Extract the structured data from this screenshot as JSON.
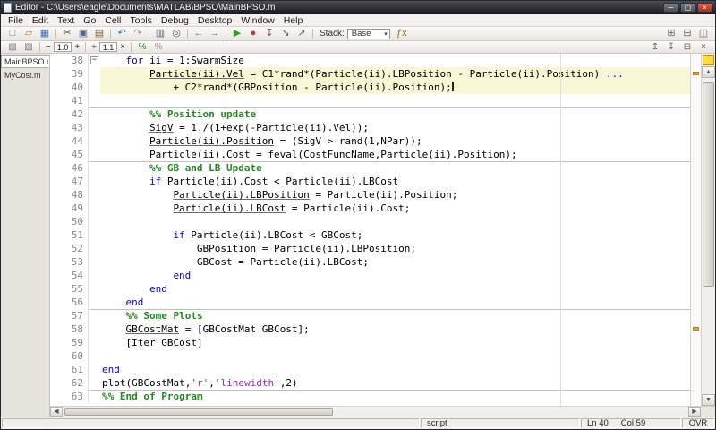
{
  "window": {
    "title": "Editor - C:\\Users\\eagle\\Documents\\MATLAB\\BPSO\\MainBPSO.m",
    "controls": {
      "minimize": "─",
      "maximize": "▢",
      "close": "×"
    }
  },
  "icons": {
    "up": "▲",
    "down": "▼",
    "left": "◀",
    "right": "▶"
  },
  "menu": {
    "items": [
      "File",
      "Edit",
      "Text",
      "Go",
      "Cell",
      "Tools",
      "Debug",
      "Desktop",
      "Window",
      "Help"
    ]
  },
  "toolbar1": {
    "stack_label": "Stack:",
    "stack_value": "Base",
    "items": [
      {
        "n": "new-script-icon",
        "g": "□",
        "c": "#6f6f6f"
      },
      {
        "n": "open-file-icon",
        "g": "▱",
        "c": "#b8860b"
      },
      {
        "n": "save-icon",
        "g": "▦",
        "c": "#3b66b0"
      },
      {
        "sep": true
      },
      {
        "n": "cut-icon",
        "g": "✂",
        "c": "#555555"
      },
      {
        "n": "copy-icon",
        "g": "▣",
        "c": "#556688"
      },
      {
        "n": "paste-icon",
        "g": "▤",
        "c": "#8a5a2a"
      },
      {
        "sep": true
      },
      {
        "n": "undo-icon",
        "g": "↶",
        "c": "#2d7dc1"
      },
      {
        "n": "redo-icon",
        "g": "↷",
        "c": "#9a9a9a"
      },
      {
        "sep": true
      },
      {
        "n": "print-icon",
        "g": "▥",
        "c": "#5a5a66"
      },
      {
        "n": "find-files-icon",
        "g": "◎",
        "c": "#5a5a66"
      },
      {
        "sep": true
      },
      {
        "n": "back-icon",
        "g": "←",
        "c": "#2d7dc1"
      },
      {
        "n": "forward-icon",
        "g": "→",
        "c": "#2d7dc1"
      },
      {
        "sep": true
      },
      {
        "n": "run-icon",
        "g": "▶",
        "c": "#2f9e2f"
      },
      {
        "n": "breakpoint-icon",
        "g": "●",
        "c": "#c23b2e"
      },
      {
        "n": "step-icon",
        "g": "↧",
        "c": "#55606e"
      },
      {
        "n": "step-in-icon",
        "g": "↘",
        "c": "#55606e"
      },
      {
        "n": "step-out-icon",
        "g": "↗",
        "c": "#55606e"
      },
      {
        "sep": true
      },
      {
        "stack": true
      },
      {
        "n": "function-browser-icon",
        "g": "ƒx",
        "c": "#8a6d1f"
      }
    ],
    "right_icons": [
      {
        "n": "tile-windows-icon",
        "g": "⊞",
        "c": "#666666"
      },
      {
        "n": "dock-icon",
        "g": "⊟",
        "c": "#666666"
      },
      {
        "n": "undock-icon",
        "g": "◫",
        "c": "#666666"
      }
    ]
  },
  "toolbar2": {
    "items": [
      {
        "n": "insert-cell-icon",
        "g": "▧",
        "c": "#777777"
      },
      {
        "n": "cell-titles-icon",
        "g": "▨",
        "c": "#777777"
      },
      {
        "sep": true
      },
      {
        "n": "decrease-value-button",
        "txt": "−"
      },
      {
        "n": "value-field",
        "txt": "1.0",
        "field": true
      },
      {
        "n": "increase-value-button",
        "txt": "+"
      },
      {
        "sep": true
      },
      {
        "n": "divide-value-button",
        "txt": "÷"
      },
      {
        "n": "value2-field",
        "txt": "1.1",
        "field": true
      },
      {
        "n": "multiply-value-button",
        "txt": "×"
      },
      {
        "sep": true
      },
      {
        "n": "comment-icon",
        "g": "%",
        "c": "#2f7d2f"
      },
      {
        "n": "uncomment-icon",
        "g": "%",
        "c": "#999999"
      }
    ],
    "right_icons": [
      {
        "n": "scroll-up-icon",
        "g": "↥",
        "c": "#666666"
      },
      {
        "n": "scroll-down-icon",
        "g": "↧",
        "c": "#666666"
      },
      {
        "n": "dock-editor-icon",
        "g": "⊟",
        "c": "#666666"
      },
      {
        "n": "close-editor-icon",
        "g": "×",
        "c": "#993333"
      }
    ]
  },
  "tabs": [
    {
      "label": "MainBPSO.m",
      "active": true,
      "closable": true
    },
    {
      "label": "MyCost.m",
      "active": false
    }
  ],
  "colors": {
    "kw": "#0000ff",
    "cm": "#228b22",
    "str": "#a020f0",
    "hl": "#f7f6d5",
    "flag": "#ffd942"
  },
  "editor": {
    "mlint_marks": [
      {
        "line": 39
      },
      {
        "line": 58
      }
    ],
    "lines": [
      {
        "n": 38,
        "i": 4,
        "fold": true,
        "seg": [
          {
            "t": "for",
            "c": "kw"
          },
          {
            "t": " ii = 1:SwarmSize",
            "c": "pl"
          }
        ]
      },
      {
        "n": 39,
        "i": 8,
        "hl": true,
        "seg": [
          {
            "t": "Particle(ii).Vel",
            "c": "pl",
            "u": true
          },
          {
            "t": " = C1*rand*(Particle(ii).LBPosition - Particle(ii).Position) ",
            "c": "pl"
          },
          {
            "t": "...",
            "c": "kw"
          }
        ]
      },
      {
        "n": 40,
        "i": 12,
        "hl": true,
        "caret": true,
        "seg": [
          {
            "t": "+ C2*rand*(GBPosition - Particle(ii).Position);",
            "c": "pl"
          }
        ]
      },
      {
        "n": 41,
        "i": 0,
        "seg": []
      },
      {
        "n": 42,
        "i": 8,
        "div": true,
        "seg": [
          {
            "t": "%% Position update",
            "c": "cm"
          }
        ]
      },
      {
        "n": 43,
        "i": 8,
        "seg": [
          {
            "t": "SigV",
            "c": "pl",
            "u": true
          },
          {
            "t": " = 1./(1+exp(-Particle(ii).Vel));",
            "c": "pl"
          }
        ]
      },
      {
        "n": 44,
        "i": 8,
        "seg": [
          {
            "t": "Particle(ii).Position",
            "c": "pl",
            "u": true
          },
          {
            "t": " = (SigV > rand(1,NPar));",
            "c": "pl"
          }
        ]
      },
      {
        "n": 45,
        "i": 8,
        "seg": [
          {
            "t": "Particle(ii).Cost",
            "c": "pl",
            "u": true
          },
          {
            "t": " = feval(CostFuncName,Particle(ii).Position);",
            "c": "pl"
          }
        ]
      },
      {
        "n": 46,
        "i": 8,
        "div": true,
        "seg": [
          {
            "t": "%% GB and LB Update",
            "c": "cm"
          }
        ]
      },
      {
        "n": 47,
        "i": 8,
        "seg": [
          {
            "t": "if",
            "c": "kw"
          },
          {
            "t": " Particle(ii).Cost < Particle(ii).LBCost",
            "c": "pl"
          }
        ]
      },
      {
        "n": 48,
        "i": 12,
        "seg": [
          {
            "t": "Particle(ii).LBPosition",
            "c": "pl",
            "u": true
          },
          {
            "t": " = Particle(ii).Position;",
            "c": "pl"
          }
        ]
      },
      {
        "n": 49,
        "i": 12,
        "seg": [
          {
            "t": "Particle(ii).LBCost",
            "c": "pl",
            "u": true
          },
          {
            "t": " = Particle(ii).Cost;",
            "c": "pl"
          }
        ]
      },
      {
        "n": 50,
        "i": 0,
        "seg": []
      },
      {
        "n": 51,
        "i": 12,
        "seg": [
          {
            "t": "if",
            "c": "kw"
          },
          {
            "t": " Particle(ii).LBCost < GBCost;",
            "c": "pl"
          }
        ]
      },
      {
        "n": 52,
        "i": 16,
        "seg": [
          {
            "t": "GBPosition = Particle(ii).LBPosition;",
            "c": "pl"
          }
        ]
      },
      {
        "n": 53,
        "i": 16,
        "seg": [
          {
            "t": "GBCost = Particle(ii).LBCost;",
            "c": "pl"
          }
        ]
      },
      {
        "n": 54,
        "i": 12,
        "seg": [
          {
            "t": "end",
            "c": "kw"
          }
        ]
      },
      {
        "n": 55,
        "i": 8,
        "seg": [
          {
            "t": "end",
            "c": "kw"
          }
        ]
      },
      {
        "n": 56,
        "i": 4,
        "seg": [
          {
            "t": "end",
            "c": "kw"
          }
        ]
      },
      {
        "n": 57,
        "i": 4,
        "div": true,
        "seg": [
          {
            "t": "%% Some Plots",
            "c": "cm"
          }
        ]
      },
      {
        "n": 58,
        "i": 4,
        "seg": [
          {
            "t": "GBCostMat",
            "c": "pl",
            "u": true
          },
          {
            "t": " = [GBCostMat GBCost];",
            "c": "pl"
          }
        ]
      },
      {
        "n": 59,
        "i": 4,
        "seg": [
          {
            "t": "[Iter GBCost]",
            "c": "pl"
          }
        ]
      },
      {
        "n": 60,
        "i": 0,
        "seg": []
      },
      {
        "n": 61,
        "i": 0,
        "seg": [
          {
            "t": "end",
            "c": "kw"
          }
        ]
      },
      {
        "n": 62,
        "i": 0,
        "seg": [
          {
            "t": "plot(GBCostMat,",
            "c": "pl"
          },
          {
            "t": "'r'",
            "c": "str"
          },
          {
            "t": ",",
            "c": "pl"
          },
          {
            "t": "'linewidth'",
            "c": "str"
          },
          {
            "t": ",2)",
            "c": "pl"
          }
        ]
      },
      {
        "n": 63,
        "i": 0,
        "div": true,
        "seg": [
          {
            "t": "%% End of Program",
            "c": "cm"
          }
        ]
      }
    ]
  },
  "status": {
    "script_label": "script",
    "line": "Ln 40",
    "col": "Col 59",
    "mode": "OVR"
  }
}
